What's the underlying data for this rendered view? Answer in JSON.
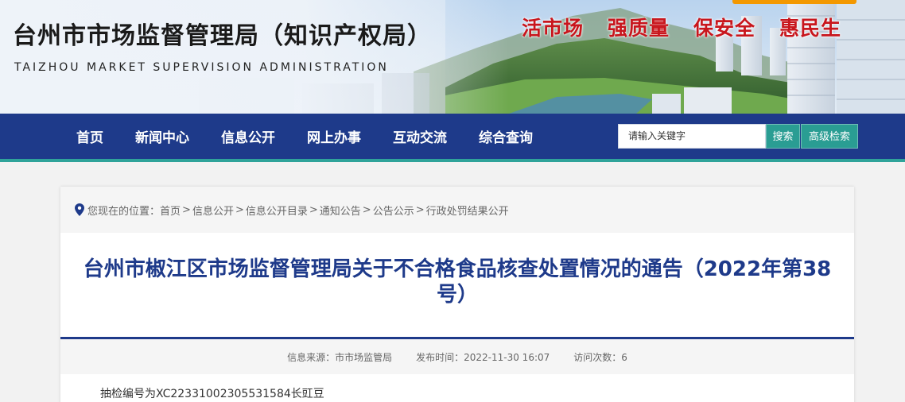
{
  "header": {
    "site_title": "台州市市场监督管理局（知识产权局）",
    "site_subtitle": "TAIZHOU MARKET SUPERVISION ADMINISTRATION",
    "slogans": [
      "活市场",
      "强质量",
      "保安全",
      "惠民生"
    ]
  },
  "nav": {
    "items": [
      "首页",
      "新闻中心",
      "信息公开",
      "网上办事",
      "互动交流",
      "综合查询"
    ],
    "search_placeholder": "请输入关键字",
    "search_button": "搜索",
    "advanced_search_button": "高级检索"
  },
  "breadcrumb": {
    "prefix": "您现在的位置：",
    "items": [
      "首页",
      "信息公开",
      "信息公开目录",
      "通知公告",
      "公告公示",
      "行政处罚结果公开"
    ],
    "separator": ">"
  },
  "article": {
    "title": "台州市椒江区市场监督管理局关于不合格食品核查处置情况的通告（2022年第38号）",
    "meta": {
      "source_label": "信息来源：",
      "source": "市市场监管局",
      "time_label": "发布时间：",
      "time": "2022-11-30 16:07",
      "views_label": "访问次数：",
      "views": "6"
    },
    "body_first_line": "抽检编号为XC22331002305531584长豇豆"
  },
  "colors": {
    "nav_bg": "#1e3a8a",
    "accent_teal": "#2a9d93",
    "slogan_red": "#c8161d",
    "title_blue": "#1e3a8a",
    "top_bar_orange": "#f39800"
  }
}
